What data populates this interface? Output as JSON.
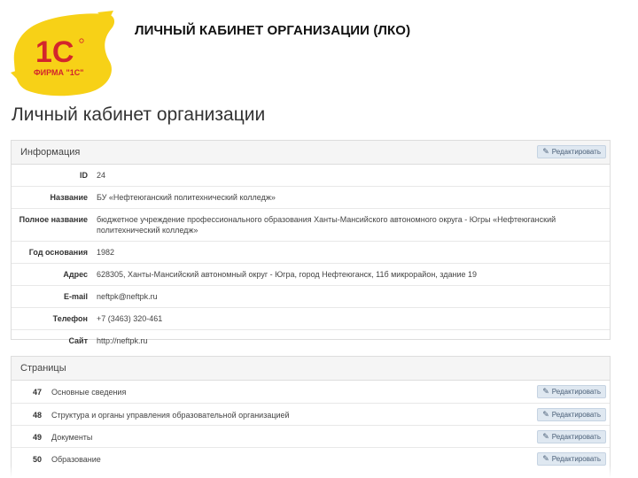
{
  "slide": {
    "title": "ЛИЧНЫЙ КАБИНЕТ ОРГАНИЗАЦИИ (ЛКО)",
    "logo_text": "ФИРМА \"1С\"",
    "logo_mark": "1С"
  },
  "page": {
    "heading": "Личный кабинет организации"
  },
  "info": {
    "title": "Информация",
    "edit_label": "Редактировать",
    "rows": [
      {
        "label": "ID",
        "value": "24"
      },
      {
        "label": "Название",
        "value": "БУ «Нефтеюганский политехнический колледж»"
      },
      {
        "label": "Полное название",
        "value": "бюджетное учреждение профессионального образования Ханты-Мансийского автономного округа - Югры «Нефтеюганский политехнический колледж»"
      },
      {
        "label": "Год основания",
        "value": "1982"
      },
      {
        "label": "Адрес",
        "value": "628305, Ханты-Мансийский автономный округ - Югра, город Нефтеюганск, 11б микрорайон, здание 19"
      },
      {
        "label": "E-mail",
        "value": "neftpk@neftpk.ru"
      },
      {
        "label": "Телефон",
        "value": "+7 (3463) 320-461"
      },
      {
        "label": "Сайт",
        "value": "http://neftpk.ru"
      }
    ]
  },
  "pages": {
    "title": "Страницы",
    "edit_label": "Редактировать",
    "items": [
      {
        "id": "47",
        "name": "Основные сведения"
      },
      {
        "id": "48",
        "name": "Структура и органы управления образовательной организацией"
      },
      {
        "id": "49",
        "name": "Документы"
      },
      {
        "id": "50",
        "name": "Образование"
      }
    ]
  },
  "colors": {
    "logo_yellow": "#f7d117",
    "logo_red": "#d3262c",
    "button_bg": "#dfe8f1"
  }
}
